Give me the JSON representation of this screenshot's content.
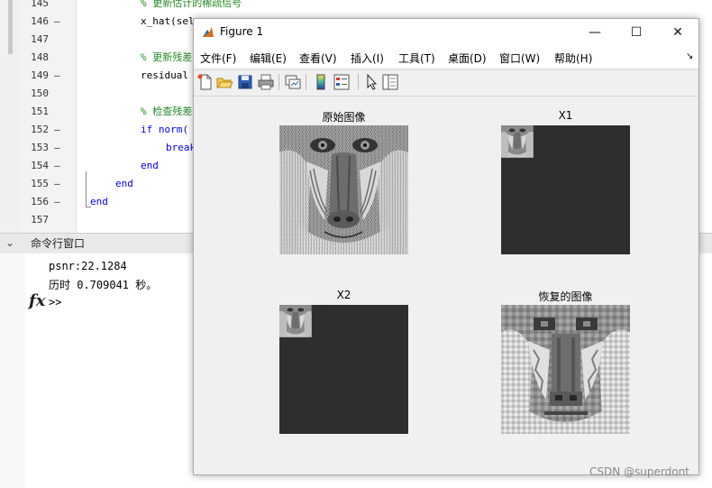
{
  "editor": {
    "lines": [
      {
        "num": "145",
        "dash": false,
        "indent": 156,
        "text": "% 更新估计的稀疏信号",
        "type": "comment"
      },
      {
        "num": "146",
        "dash": true,
        "indent": 156,
        "text": "x_hat(sel",
        "type": "code"
      },
      {
        "num": "147",
        "dash": false,
        "indent": 156,
        "text": "",
        "type": "code"
      },
      {
        "num": "148",
        "dash": false,
        "indent": 156,
        "text": "% 更新残差",
        "type": "comment"
      },
      {
        "num": "149",
        "dash": true,
        "indent": 156,
        "text": "residual",
        "type": "code"
      },
      {
        "num": "150",
        "dash": false,
        "indent": 156,
        "text": "",
        "type": "code"
      },
      {
        "num": "151",
        "dash": false,
        "indent": 156,
        "text": "% 检查残差",
        "type": "comment"
      },
      {
        "num": "152",
        "dash": true,
        "indent": 156,
        "text": "if norm(",
        "type": "keyword"
      },
      {
        "num": "153",
        "dash": true,
        "indent": 184,
        "text": "break",
        "type": "keyword"
      },
      {
        "num": "154",
        "dash": true,
        "indent": 156,
        "text": "end",
        "type": "keyword"
      },
      {
        "num": "155",
        "dash": true,
        "indent": 128,
        "text": "end",
        "type": "keyword"
      },
      {
        "num": "156",
        "dash": true,
        "indent": 100,
        "text": "end",
        "type": "keyword"
      },
      {
        "num": "157",
        "dash": false,
        "indent": 100,
        "text": "",
        "type": "code"
      }
    ]
  },
  "command_window": {
    "title": "命令行窗口",
    "output": [
      "psnr:22.1284",
      "历时 0.709041 秒。"
    ],
    "prompt": ">>",
    "fx_label": "fx"
  },
  "figure": {
    "title": "Figure 1",
    "menus": [
      "文件(F)",
      "编辑(E)",
      "查看(V)",
      "插入(I)",
      "工具(T)",
      "桌面(D)",
      "窗口(W)",
      "帮助(H)"
    ],
    "toolbar_icons": [
      "new-figure-icon",
      "open-file-icon",
      "save-icon",
      "print-icon",
      "link-plot-icon",
      "insert-colorbar-icon",
      "insert-legend-icon",
      "edit-plot-icon",
      "property-inspector-icon"
    ],
    "axes": [
      {
        "title": "原始图像",
        "kind": "original"
      },
      {
        "title": "X1",
        "kind": "x1"
      },
      {
        "title": "X2",
        "kind": "x2"
      },
      {
        "title": "恢复的图像",
        "kind": "recovered"
      }
    ]
  },
  "watermark": "CSDN @superdont"
}
